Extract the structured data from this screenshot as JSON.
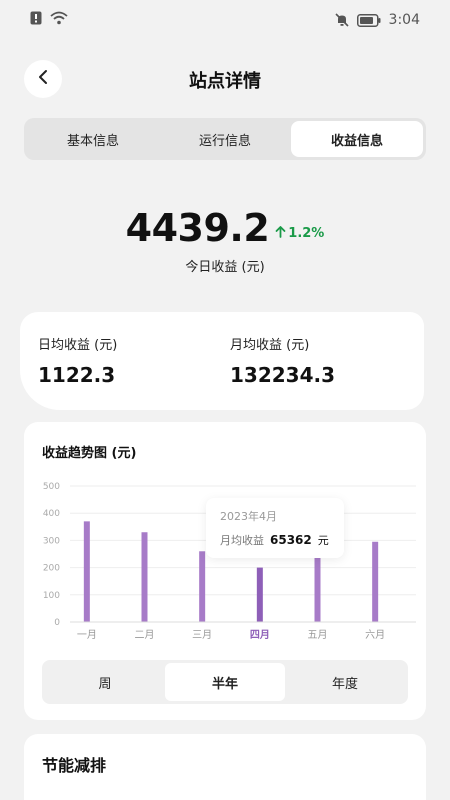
{
  "status": {
    "time": "3:04"
  },
  "header": {
    "title": "站点详情"
  },
  "tabs": [
    {
      "label": "基本信息",
      "active": false
    },
    {
      "label": "运行信息",
      "active": false
    },
    {
      "label": "收益信息",
      "active": true
    }
  ],
  "summary": {
    "today_value": "4439.2",
    "change": "1.2%",
    "change_direction": "up",
    "today_label": "今日收益 (元)"
  },
  "averages": {
    "daily_label": "日均收益 (元)",
    "daily_value": "1122.3",
    "monthly_label": "月均收益 (元)",
    "monthly_value": "132234.3"
  },
  "chart": {
    "title": "收益趋势图 (元)",
    "tooltip": {
      "date": "2023年4月",
      "label": "月均收益",
      "value": "65362",
      "unit": "元"
    }
  },
  "chart_data": {
    "type": "bar",
    "categories": [
      "一月",
      "二月",
      "三月",
      "四月",
      "五月",
      "六月"
    ],
    "values": [
      370,
      330,
      260,
      200,
      240,
      295
    ],
    "ylim": [
      0,
      500
    ],
    "yticks": [
      0,
      100,
      200,
      300,
      400,
      500
    ],
    "highlighted_category": "四月",
    "grid": true,
    "bar_color": "#a77bc8",
    "highlight_color": "#8e5fb8"
  },
  "periods": [
    {
      "label": "周",
      "active": false
    },
    {
      "label": "半年",
      "active": true
    },
    {
      "label": "年度",
      "active": false
    }
  ],
  "energy": {
    "title": "节能减排"
  },
  "colors": {
    "accent_green": "#1a9a48",
    "bar": "#a77bc8"
  }
}
